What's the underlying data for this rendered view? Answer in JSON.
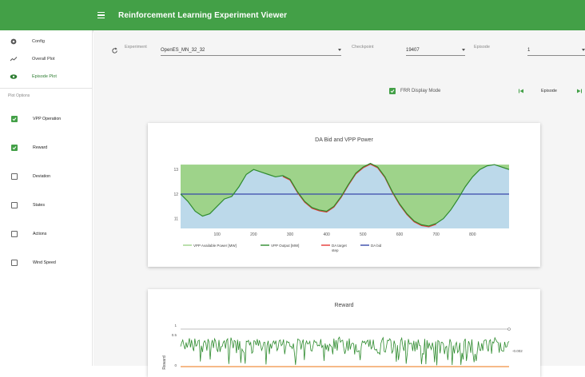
{
  "appbar": {
    "title": "Reinforcement Learning Experiment Viewer"
  },
  "sidebar": {
    "nav": [
      {
        "label": "Config",
        "icon": "gear-icon"
      },
      {
        "label": "Overall Plot",
        "icon": "line-chart-icon"
      },
      {
        "label": "Episode Plot",
        "icon": "eye-icon",
        "active": true
      }
    ],
    "subheader": "Plot Options",
    "options": [
      {
        "label": "VPP Operation",
        "checked": true
      },
      {
        "label": "Reward",
        "checked": true
      },
      {
        "label": "Deviation",
        "checked": false
      },
      {
        "label": "States",
        "checked": false
      },
      {
        "label": "Actions",
        "checked": false
      },
      {
        "label": "Wind Speed",
        "checked": false
      }
    ]
  },
  "controls": {
    "experiment_label": "Experiment",
    "experiment_value": "OpenES_MN_32_32",
    "checkpoint_label": "Checkpoint",
    "checkpoint_value": "19407",
    "episode_label": "Episode",
    "episode_value": "1",
    "fr_label": "FRR Display Mode",
    "fr_checked": true,
    "episode_nav_label": "Episode"
  },
  "accent_color": "#43a047",
  "chart_data": [
    {
      "type": "area",
      "title": "DA Bid and VPP Power",
      "x_ticks": [
        "100",
        "200",
        "300",
        "400",
        "500",
        "600",
        "700",
        "800"
      ],
      "y_ticks": [
        "11",
        "12",
        "13"
      ],
      "xlim": [
        0,
        900
      ],
      "ylim": [
        10.6,
        13.3
      ],
      "legend": [
        "VPP Available Power [MW]",
        "VPP Output [MW]",
        "DA target step",
        "DA bid"
      ],
      "colors": {
        "available": "#9ed38a",
        "output": "#2e8b2e",
        "target": "#e53935",
        "bid": "#3949ab",
        "under": "#bcd9ea"
      },
      "series": [
        {
          "name": "VPP Available Power [MW]",
          "x": [
            0,
            900
          ],
          "y": [
            13.2,
            13.2
          ]
        },
        {
          "name": "DA bid",
          "x": [
            0,
            900
          ],
          "y": [
            12.0,
            12.0
          ]
        },
        {
          "name": "VPP Output [MW]",
          "x": [
            0,
            20,
            40,
            60,
            80,
            100,
            120,
            140,
            160,
            180,
            200,
            220,
            240,
            260,
            280,
            300,
            320,
            340,
            360,
            380,
            400,
            420,
            440,
            460,
            480,
            500,
            520,
            540,
            560,
            580,
            600,
            620,
            640,
            660,
            680,
            700,
            720,
            740,
            760,
            780,
            800,
            820,
            840,
            860,
            880,
            900
          ],
          "y": [
            12.0,
            11.7,
            11.3,
            11.1,
            11.2,
            11.5,
            11.8,
            11.9,
            12.3,
            12.8,
            13.0,
            12.9,
            12.8,
            12.7,
            12.75,
            12.6,
            12.1,
            11.7,
            11.45,
            11.35,
            11.3,
            11.5,
            11.9,
            12.4,
            12.85,
            13.1,
            13.25,
            13.1,
            12.7,
            12.1,
            11.6,
            11.2,
            10.9,
            10.75,
            10.7,
            10.8,
            11.0,
            11.35,
            11.8,
            12.3,
            12.7,
            13.0,
            13.15,
            13.2,
            13.1,
            13.0
          ]
        },
        {
          "name": "DA target step",
          "x": [
            280,
            300,
            320,
            340,
            360,
            380,
            400,
            420,
            440,
            460,
            480,
            500,
            520,
            540,
            560,
            580,
            600,
            620,
            640,
            660,
            680,
            700
          ],
          "y": [
            12.75,
            12.6,
            12.1,
            11.7,
            11.45,
            11.35,
            11.3,
            11.5,
            11.9,
            12.4,
            12.85,
            13.1,
            13.25,
            13.1,
            12.7,
            12.1,
            11.6,
            11.2,
            10.9,
            10.75,
            10.7,
            10.8
          ]
        }
      ]
    },
    {
      "type": "line",
      "title": "Reward",
      "y_ticks": [
        "1",
        "0.5",
        "0",
        "-0.002"
      ],
      "ylabel": "Reward",
      "colors": {
        "reward": "#2e8b2e",
        "baseline": "#f4a261"
      },
      "series": [
        {
          "name": "reward",
          "x": [
            0,
            900
          ],
          "y": [
            0.75,
            0.75
          ]
        }
      ]
    }
  ]
}
